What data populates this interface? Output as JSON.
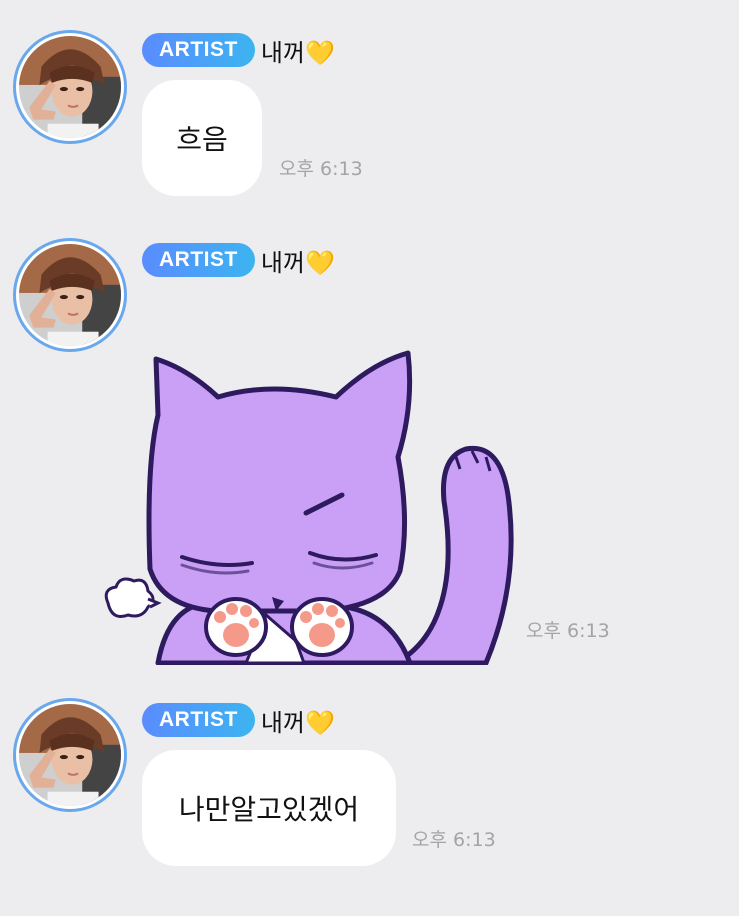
{
  "messages": [
    {
      "badge": "ARTIST",
      "nickname": "내꺼💛",
      "text": "흐음",
      "time": "오후 6:13"
    },
    {
      "badge": "ARTIST",
      "nickname": "내꺼💛",
      "sticker": "purple-cat-sleeping-sticker",
      "time": "오후 6:13"
    },
    {
      "badge": "ARTIST",
      "nickname": "내꺼💛",
      "text": "나만알고있겠어",
      "time": "오후 6:13"
    }
  ],
  "colors": {
    "background": "#ededef",
    "bubble": "#ffffff",
    "badge_start": "#5a8cff",
    "badge_end": "#3cb4f0",
    "avatar_ring": "#6aa8ee",
    "time": "#a4a4a6",
    "sticker_cat": "#c9a0f5",
    "sticker_outline": "#2e1a5e"
  }
}
